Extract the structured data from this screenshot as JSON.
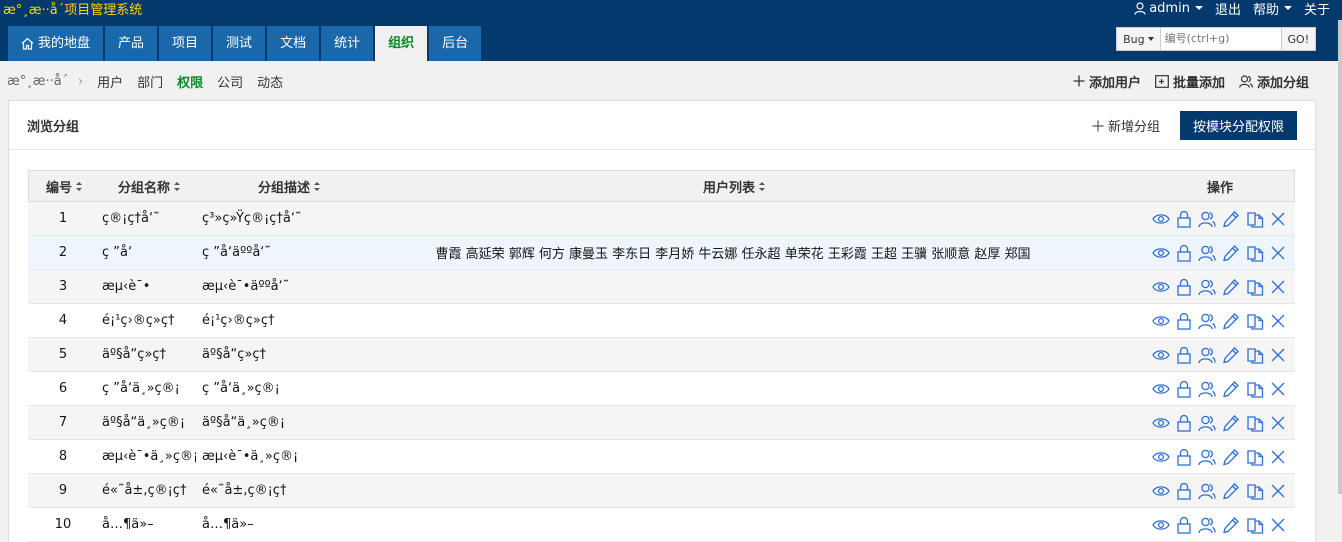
{
  "app": {
    "title": "æ°¸æ··å´项目管理系统"
  },
  "topbar": {
    "user": "admin",
    "logout": "退出",
    "help": "帮助",
    "about": "关于"
  },
  "nav": {
    "tabs": [
      {
        "label": "我的地盘",
        "active": false
      },
      {
        "label": "产品",
        "active": false
      },
      {
        "label": "项目",
        "active": false
      },
      {
        "label": "测试",
        "active": false
      },
      {
        "label": "文档",
        "active": false
      },
      {
        "label": "统计",
        "active": false
      },
      {
        "label": "组织",
        "active": true
      },
      {
        "label": "后台",
        "active": false
      }
    ]
  },
  "search": {
    "type": "Bug",
    "placeholder": "编号(ctrl+g)",
    "go": "GO!"
  },
  "subnav": {
    "crumb": "æ°¸æ··å´",
    "separator": "›",
    "links": [
      {
        "label": "用户",
        "active": false
      },
      {
        "label": "部门",
        "active": false
      },
      {
        "label": "权限",
        "active": true
      },
      {
        "label": "公司",
        "active": false
      },
      {
        "label": "动态",
        "active": false
      }
    ]
  },
  "actions": {
    "add_user": "添加用户",
    "batch_add": "批量添加",
    "add_group": "添加分组"
  },
  "panel": {
    "title": "浏览分组",
    "new_group": "新增分组",
    "assign_by_module": "按模块分配权限"
  },
  "table": {
    "headers": {
      "id": "编号",
      "name": "分组名称",
      "desc": "分组描述",
      "users": "用户列表",
      "ops": "操作"
    },
    "rows": [
      {
        "id": "1",
        "name": "ç®¡ç†å‘˜",
        "desc": "ç³»ç»Ÿç®¡ç†å‘˜",
        "users": ""
      },
      {
        "id": "2",
        "name": "ç ”å‘",
        "desc": "ç ”å‘äººå‘˜",
        "users": "曹霞 高延荣 郭辉 何方 康曼玉 李东日 李月娇 牛云娜 任永超 单荣花 王彩霞 王超 王骥 张顺意 赵厚 郑国"
      },
      {
        "id": "3",
        "name": "æµ‹è¯•",
        "desc": "æµ‹è¯•äººå‘˜",
        "users": ""
      },
      {
        "id": "4",
        "name": "é¡¹ç›®ç»ç†",
        "desc": "é¡¹ç›®ç»ç†",
        "users": ""
      },
      {
        "id": "5",
        "name": "äº§å“ç»ç†",
        "desc": "äº§å“ç»ç†",
        "users": ""
      },
      {
        "id": "6",
        "name": "ç ”å‘ä¸»ç®¡",
        "desc": "ç ”å‘ä¸»ç®¡",
        "users": ""
      },
      {
        "id": "7",
        "name": "äº§å“ä¸»ç®¡",
        "desc": "äº§å“ä¸»ç®¡",
        "users": ""
      },
      {
        "id": "8",
        "name": "æµ‹è¯•ä¸»ç®¡",
        "desc": "æµ‹è¯•ä¸»ç®¡",
        "users": ""
      },
      {
        "id": "9",
        "name": "é«˜å±‚ç®¡ç†",
        "desc": "é«˜å±‚ç®¡ç†",
        "users": ""
      },
      {
        "id": "10",
        "name": "å…¶ä»–",
        "desc": "å…¶ä»–",
        "users": ""
      }
    ]
  },
  "colors": {
    "header_bg": "#03396c",
    "tab_bg": "#1a68a9",
    "active_green": "#0a8a2a",
    "brand_yellow": "#ffd700",
    "icon_blue": "#2e6fd6",
    "row_highlight": "#eef5fd"
  },
  "icons": {
    "ops": [
      "eye-icon",
      "lock-icon",
      "users-icon",
      "pencil-icon",
      "copy-icon",
      "close-icon"
    ]
  }
}
